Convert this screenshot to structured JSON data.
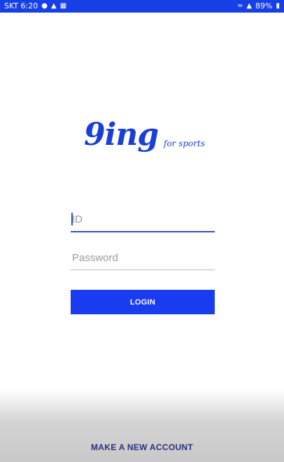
{
  "status_bar": {
    "carrier_time": "SKT 6:20",
    "left_icons": [
      "chat-icon",
      "notification-icon",
      "image-icon"
    ],
    "battery": "89%",
    "signal_text": "◀≡ ••"
  },
  "logo": {
    "main": "9ing",
    "sub": "for sports"
  },
  "login_form": {
    "id_placeholder": "ID",
    "password_placeholder": "Password",
    "login_label": "LOGIN"
  },
  "footer": {
    "make_account_label": "MAKE A NEW ACCOUNT"
  },
  "colors": {
    "brand_blue": "#1a3cf0",
    "status_bar": "#1640e6"
  }
}
